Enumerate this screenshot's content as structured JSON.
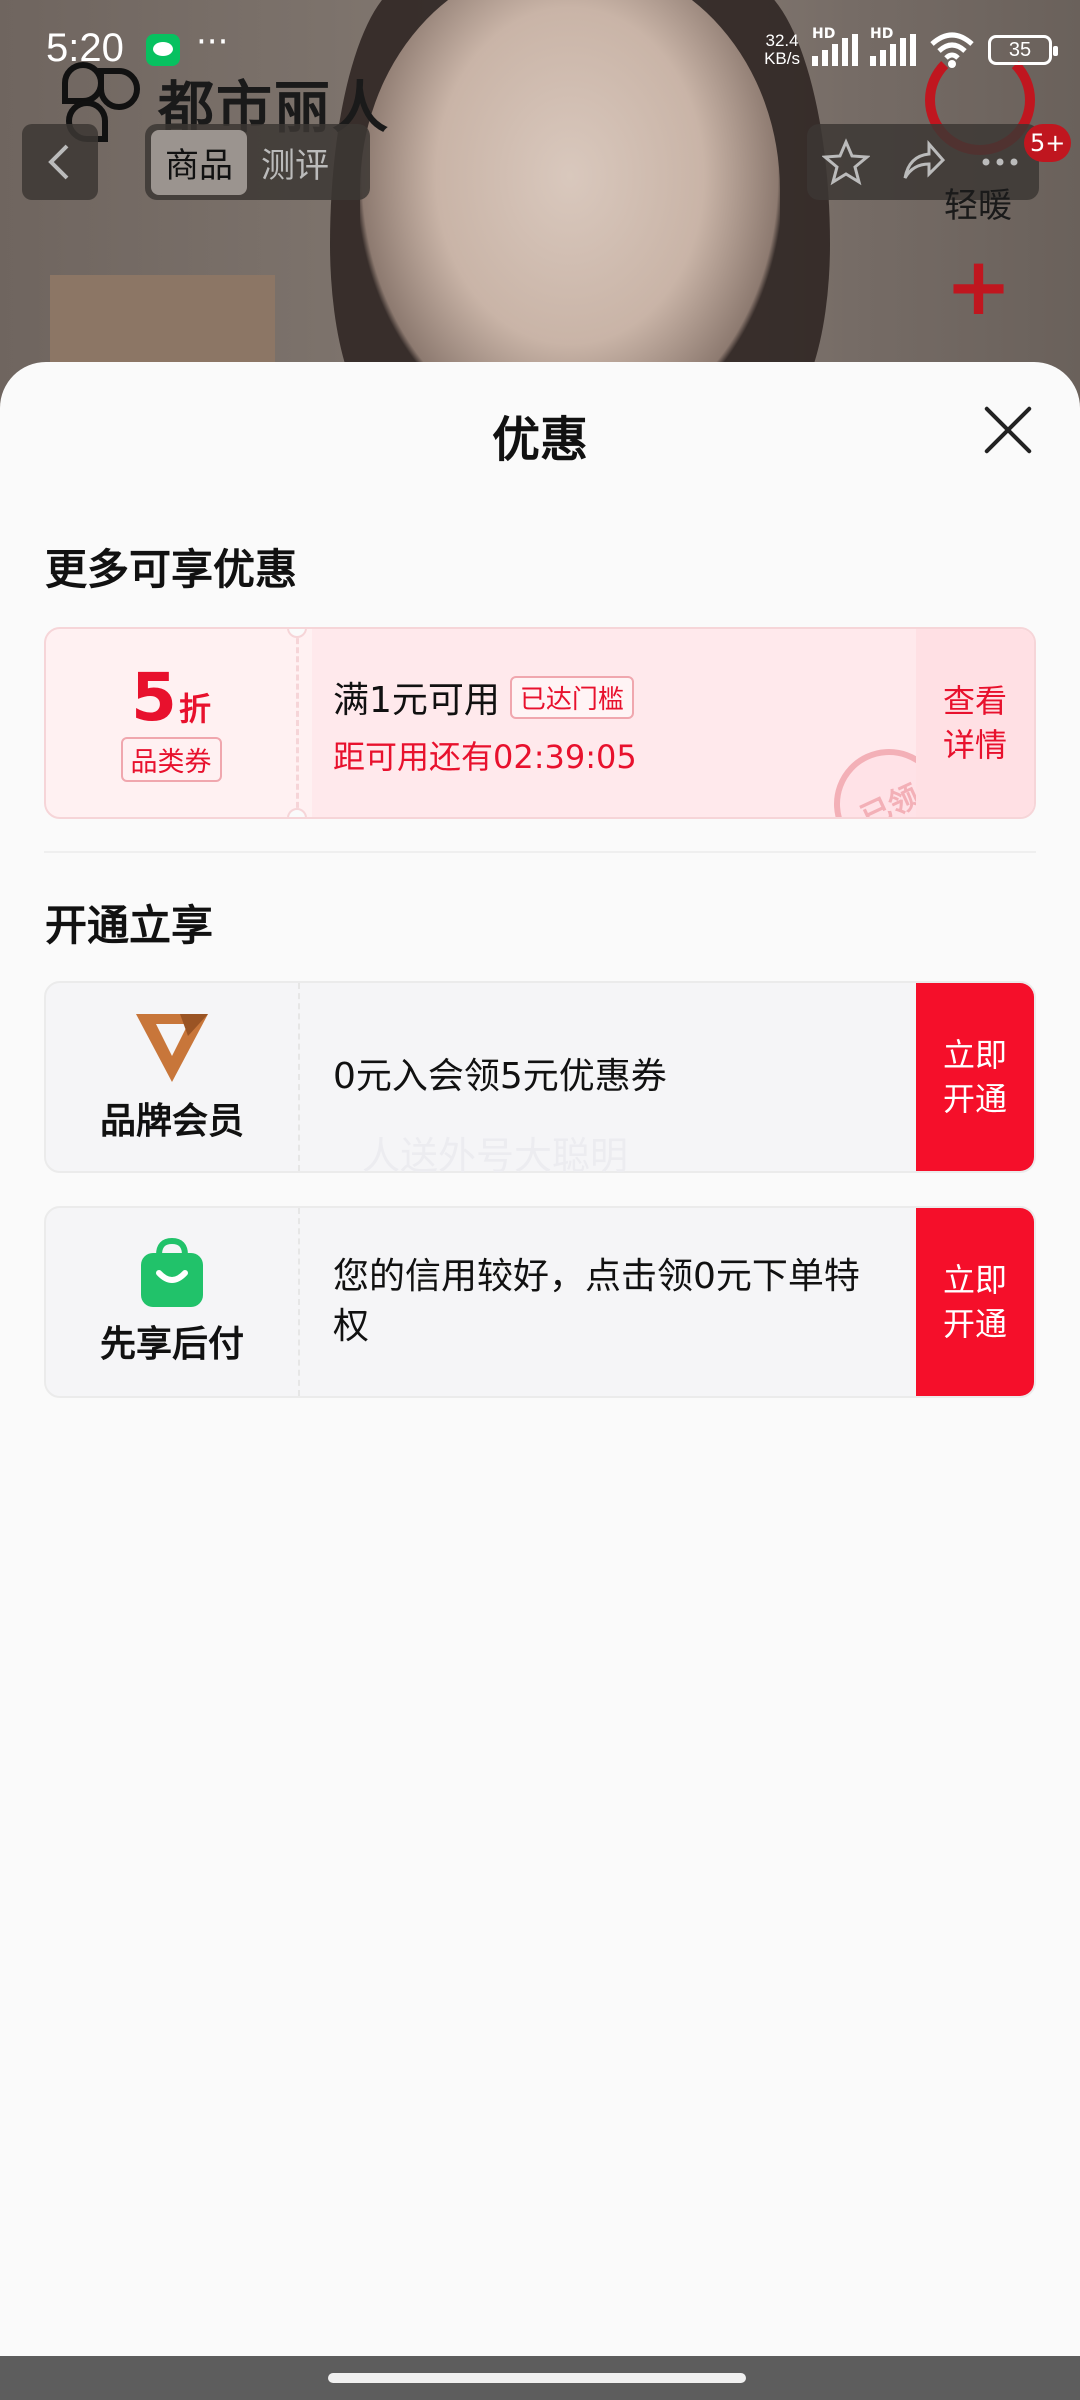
{
  "status_bar": {
    "time": "5:20",
    "dots": "···",
    "speed_top": "32.4",
    "speed_bottom": "KB/s",
    "hd1": "HD",
    "hd2": "HD",
    "battery": "35"
  },
  "background": {
    "brand_logo_text": "都市丽人",
    "tabs": [
      "商品",
      "测评"
    ],
    "cart_label": "轻暖",
    "cart_badge": "5+"
  },
  "sheet": {
    "title": "优惠",
    "section_more": "更多可享优惠",
    "coupon": {
      "amount": "5",
      "unit": "折",
      "type": "品类券",
      "condition": "满1元可用",
      "tag": "已达门槛",
      "timer": "距可用还有02:39:05",
      "stamp": "已领",
      "details_line1": "查看",
      "details_line2": "详情"
    },
    "section_open": "开通立享",
    "member": {
      "label": "品牌会员",
      "text": "0元入会领5元优惠券",
      "btn_line1": "立即",
      "btn_line2": "开通"
    },
    "paylater": {
      "label": "先享后付",
      "text": "您的信用较好，点击领0元下单特权",
      "btn_line1": "立即",
      "btn_line2": "开通"
    },
    "watermark": "人送外号大聪明"
  },
  "colors": {
    "accent_red": "#f50f2a",
    "coupon_red": "#e8112d",
    "member_bronze": "#c8763a",
    "paylater_green": "#21c26a"
  }
}
